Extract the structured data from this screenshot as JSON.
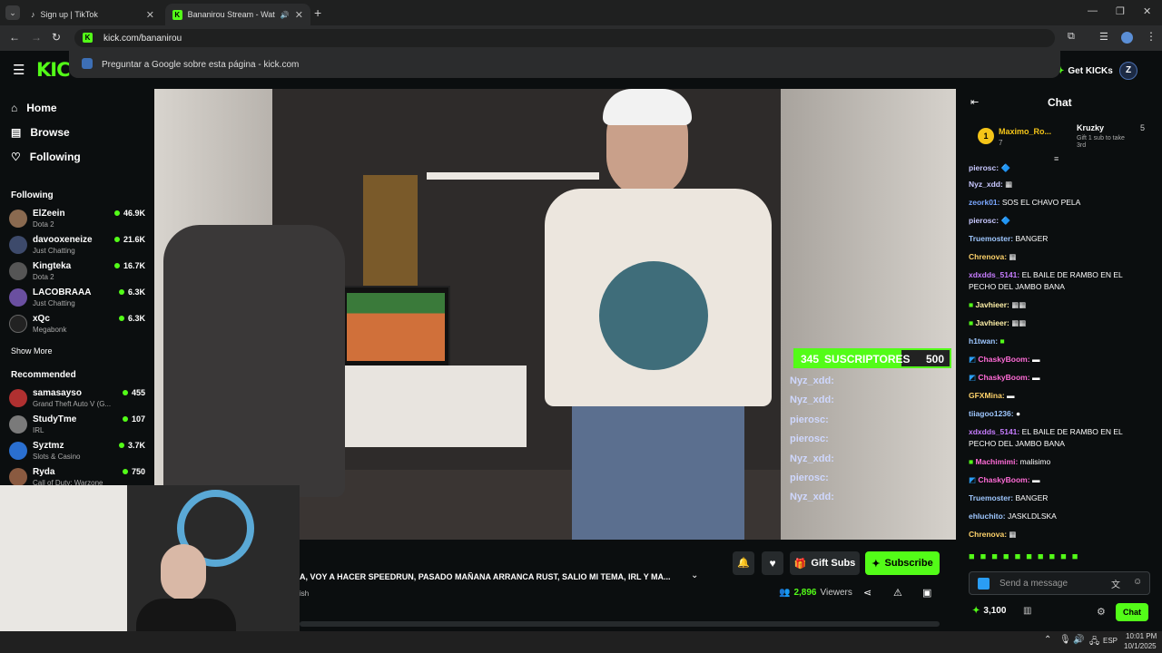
{
  "browser": {
    "tabs": [
      {
        "title": "Sign up | TikTok",
        "active": false
      },
      {
        "title": "Bananirou Stream - Watch",
        "active": true
      }
    ],
    "url": "kick.com/bananirou",
    "suggestion": "Preguntar a Google sobre esta página - kick.com"
  },
  "header": {
    "logo": "KIC",
    "get_kicks": "Get KICKs"
  },
  "nav": [
    {
      "label": "Home",
      "icon": "home-icon"
    },
    {
      "label": "Browse",
      "icon": "browse-icon"
    },
    {
      "label": "Following",
      "icon": "heart-icon"
    }
  ],
  "following_title": "Following",
  "following": [
    {
      "name": "ElZeein",
      "game": "Dota 2",
      "viewers": "46.9K"
    },
    {
      "name": "davooxeneize",
      "game": "Just Chatting",
      "viewers": "21.6K"
    },
    {
      "name": "Kingteka",
      "game": "Dota 2",
      "viewers": "16.7K"
    },
    {
      "name": "LACOBRAAA",
      "game": "Just Chatting",
      "viewers": "6.3K"
    },
    {
      "name": "xQc",
      "game": "Megabonk",
      "viewers": "6.3K"
    }
  ],
  "show_more": "Show More",
  "recommended_title": "Recommended",
  "recommended": [
    {
      "name": "samasayso",
      "game": "Grand Theft Auto V (G...",
      "viewers": "455"
    },
    {
      "name": "StudyTme",
      "game": "IRL",
      "viewers": "107"
    },
    {
      "name": "Syztmz",
      "game": "Slots & Casino",
      "viewers": "3.7K"
    },
    {
      "name": "Ryda",
      "game": "Call of Duty: Warzone",
      "viewers": "750"
    }
  ],
  "overlay": {
    "subs_current": "345",
    "subs_label": "SUSCRIPTORES",
    "subs_goal": "500",
    "subs_progress": 0.69,
    "names": [
      "Nyz_xdd:",
      "Nyz_xdd:",
      "pierosc:",
      "pierosc:",
      "Nyz_xdd:",
      "pierosc:",
      "Nyz_xdd:"
    ]
  },
  "stream": {
    "title": "A, VOY A HACER SPEEDRUN, PASADO MAÑANA ARRANCA RUST, SALIO MI TEMA, IRL Y MA...",
    "lang": "ish",
    "viewers": "2,896",
    "viewers_label": "Viewers",
    "gift_subs": "Gift Subs",
    "subscribe": "Subscribe"
  },
  "chat": {
    "title": "Chat",
    "pinned_rank": "1",
    "pinned_user": "Maximo_Ro...",
    "pinned_count": "7",
    "gift_user": "Kruzky",
    "gift_count": "5",
    "gift_text": "Gift 1 sub to take 3rd",
    "messages": [
      {
        "user": "pierosc:",
        "color": "#c8c8ff",
        "text": ""
      },
      {
        "user": "Nyz_xdd:",
        "color": "#c8c8ff",
        "text": ""
      },
      {
        "user": "zeork01:",
        "color": "#7aa7ff",
        "text": "SOS EL CHAVO PELA"
      },
      {
        "user": "pierosc:",
        "color": "#c8c8ff",
        "text": ""
      },
      {
        "user": "Truemoster:",
        "color": "#9ec7ff",
        "text": "BANGER"
      },
      {
        "user": "Chrenova:",
        "color": "#ffd36b",
        "text": ""
      },
      {
        "user": "xdxdds_5141:",
        "color": "#c77dff",
        "text": "EL BAILE DE RAMBO EN EL PECHO DEL JAMBO BANA"
      },
      {
        "user": "Javhieer:",
        "color": "#fff1a8",
        "text": ""
      },
      {
        "user": "Javhieer:",
        "color": "#fff1a8",
        "text": ""
      },
      {
        "user": "h1twan:",
        "color": "#9ec7ff",
        "text": ""
      },
      {
        "user": "ChaskyBoom:",
        "color": "#ff6bd6",
        "text": ""
      },
      {
        "user": "ChaskyBoom:",
        "color": "#ff6bd6",
        "text": ""
      },
      {
        "user": "GFXMina:",
        "color": "#ffd36b",
        "text": ""
      },
      {
        "user": "tiiagoo1236:",
        "color": "#9ec7ff",
        "text": ""
      },
      {
        "user": "xdxdds_5141:",
        "color": "#c77dff",
        "text": "EL BAILE DE RAMBO EN EL PECHO DEL JAMBO BANA"
      },
      {
        "user": "Machimimi:",
        "color": "#ff6bd6",
        "text": "malisimo"
      },
      {
        "user": "ChaskyBoom:",
        "color": "#ff6bd6",
        "text": ""
      },
      {
        "user": "Truemoster:",
        "color": "#9ec7ff",
        "text": "BANGER"
      },
      {
        "user": "ehluchito:",
        "color": "#9ec7ff",
        "text": "JASKLDLSKA"
      },
      {
        "user": "Chrenova:",
        "color": "#ffd36b",
        "text": ""
      }
    ],
    "placeholder": "Send a message",
    "kicks": "3,100",
    "send": "Chat"
  },
  "taskbar": {
    "lang": "ESP",
    "time": "10:01 PM",
    "date": "10/1/2025"
  },
  "colors": {
    "accent": "#53fc18"
  }
}
